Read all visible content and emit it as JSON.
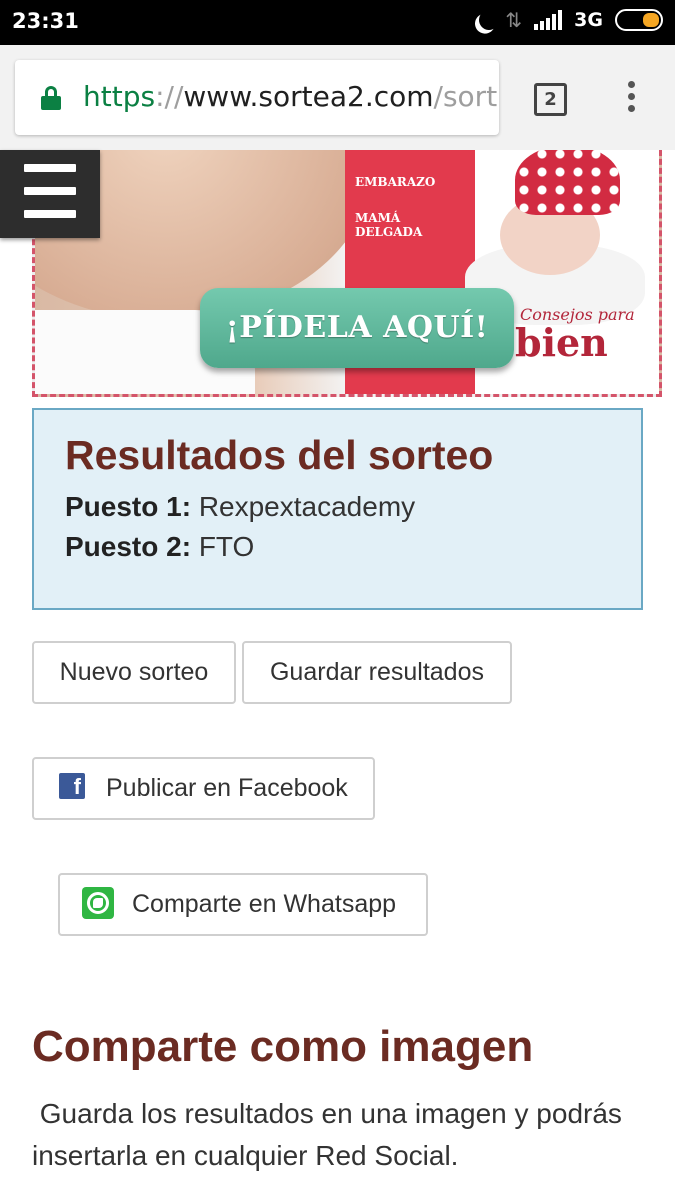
{
  "status_bar": {
    "time": "23:31",
    "network": "3G",
    "icons": [
      "moon-icon",
      "data-arrows-icon",
      "signal-icon",
      "battery-icon"
    ],
    "battery_color": "#f5a623"
  },
  "browser": {
    "url_scheme": "https",
    "url_sep": "://",
    "url_host": "www.sortea2.com",
    "url_path": "/sort",
    "tab_count": "2",
    "secure_color": "#0b8043"
  },
  "banner": {
    "cta_label": "¡PÍDELA AQUÍ!",
    "magazine_text": "bien",
    "magazine_sub": "Consejos para",
    "cover_lines": [
      "EMBARAZO",
      "MAMÁ",
      "DELGADA"
    ],
    "border_color": "#d4546a"
  },
  "results": {
    "title": "Resultados del sorteo",
    "rows": [
      {
        "label": "Puesto 1:",
        "value": "Rexpextacademy"
      },
      {
        "label": "Puesto 2:",
        "value": "FTO"
      }
    ]
  },
  "actions": {
    "new_draw": "Nuevo sorteo",
    "save_results": "Guardar resultados",
    "facebook": "Publicar en Facebook",
    "whatsapp": "Comparte en Whatsapp"
  },
  "share_image": {
    "title": "Comparte como imagen",
    "text": " Guarda los resultados en una imagen y podrás insertarla en cualquier Red Social."
  },
  "colors": {
    "heading": "#6b2b22",
    "results_bg": "#e2f0f7",
    "results_border": "#6aa8c4",
    "facebook": "#3b5998",
    "whatsapp": "#2fb642"
  }
}
